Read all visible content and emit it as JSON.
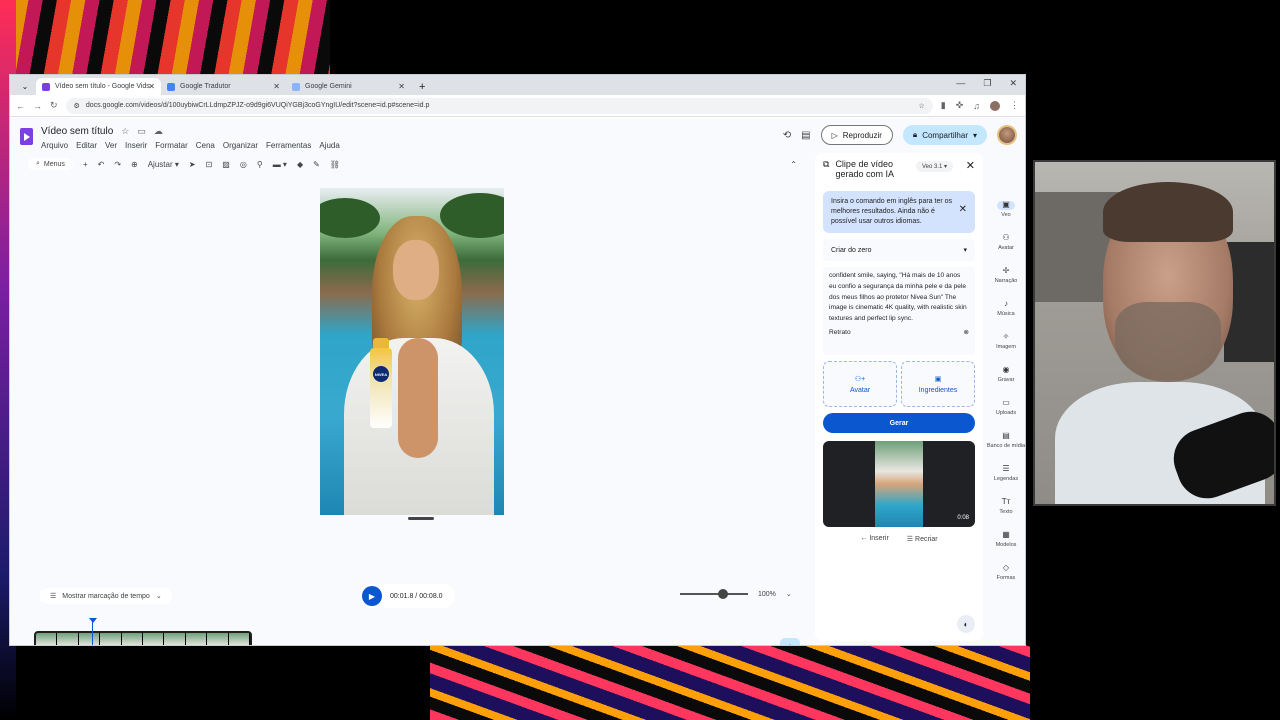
{
  "browser": {
    "tabs": [
      {
        "title": "Vídeo sem título - Google Vids",
        "favicon_color": "#7b3fe4",
        "active": true
      },
      {
        "title": "Google Tradutor",
        "favicon_color": "#4285f4",
        "active": false
      },
      {
        "title": "Google Gemini",
        "favicon_color": "#8ab4f8",
        "active": false
      }
    ],
    "url": "docs.google.com/videos/d/100uybiwCrLLdmpZPJZ-o9d9gi6VUQiYGBj3coGYngIU/edit?scene=id.p#scene=id.p"
  },
  "doc": {
    "title": "Vídeo sem título",
    "menus": [
      "Arquivo",
      "Editar",
      "Ver",
      "Inserir",
      "Formatar",
      "Cena",
      "Organizar",
      "Ferramentas",
      "Ajuda"
    ],
    "play_label": "Reproduzir",
    "share_label": "Compartilhar"
  },
  "editor_toolbar": {
    "search_label": "Menus",
    "fit_label": "Ajustar"
  },
  "timeline": {
    "marker_label": "Mostrar marcação de tempo",
    "time": "00:01.8 / 00:08.0",
    "zoom": "100%",
    "zoom_level": 0.56
  },
  "panel": {
    "title_line1": "Clipe de vídeo",
    "title_line2": "gerado com IA",
    "model": "Veo 3.1",
    "info": "Insira o comando em inglês para ter os melhores resultados. Ainda não é possível usar outros idiomas.",
    "mode": "Criar do zero",
    "prompt": "confident smile, saying, \"Há mais de 10 anos eu confio a segurança da minha pele e da pele dos meus filhos ao protetor Nivea Sun\" The image is cinematic 4K quality, with realistic skin textures and perfect lip sync.",
    "orientation": "Retrato",
    "chip_avatar": "Avatar",
    "chip_ingredients": "Ingredientes",
    "generate": "Gerar",
    "thumb_duration": "0:08",
    "insert": "Inserir",
    "recreate": "Recriar"
  },
  "rail": [
    {
      "label": "Veo",
      "icon": "veo-icon",
      "glyph": "▣"
    },
    {
      "label": "Avatar",
      "icon": "avatar-icon",
      "glyph": "⚇"
    },
    {
      "label": "Narração",
      "icon": "narration-icon",
      "glyph": "✢"
    },
    {
      "label": "Música",
      "icon": "music-icon",
      "glyph": "♪"
    },
    {
      "label": "Imagem",
      "icon": "image-icon",
      "glyph": "✧"
    },
    {
      "label": "Gravar",
      "icon": "record-icon",
      "glyph": "◉"
    },
    {
      "label": "Uploads",
      "icon": "folder-icon",
      "glyph": "▭"
    },
    {
      "label": "Banco de mídia",
      "icon": "media-library-icon",
      "glyph": "▤"
    },
    {
      "label": "Legendas",
      "icon": "captions-icon",
      "glyph": "☰"
    },
    {
      "label": "Texto",
      "icon": "text-icon",
      "glyph": "Tт"
    },
    {
      "label": "Modelos",
      "icon": "templates-icon",
      "glyph": "▦"
    },
    {
      "label": "Formas",
      "icon": "shapes-icon",
      "glyph": "◇"
    }
  ],
  "overlay": {
    "nivea_text": "NIVEA"
  },
  "colors": {
    "accent": "#0b57d0",
    "share_bg": "#c2e7ff",
    "info_bg": "#d3e3fd"
  }
}
